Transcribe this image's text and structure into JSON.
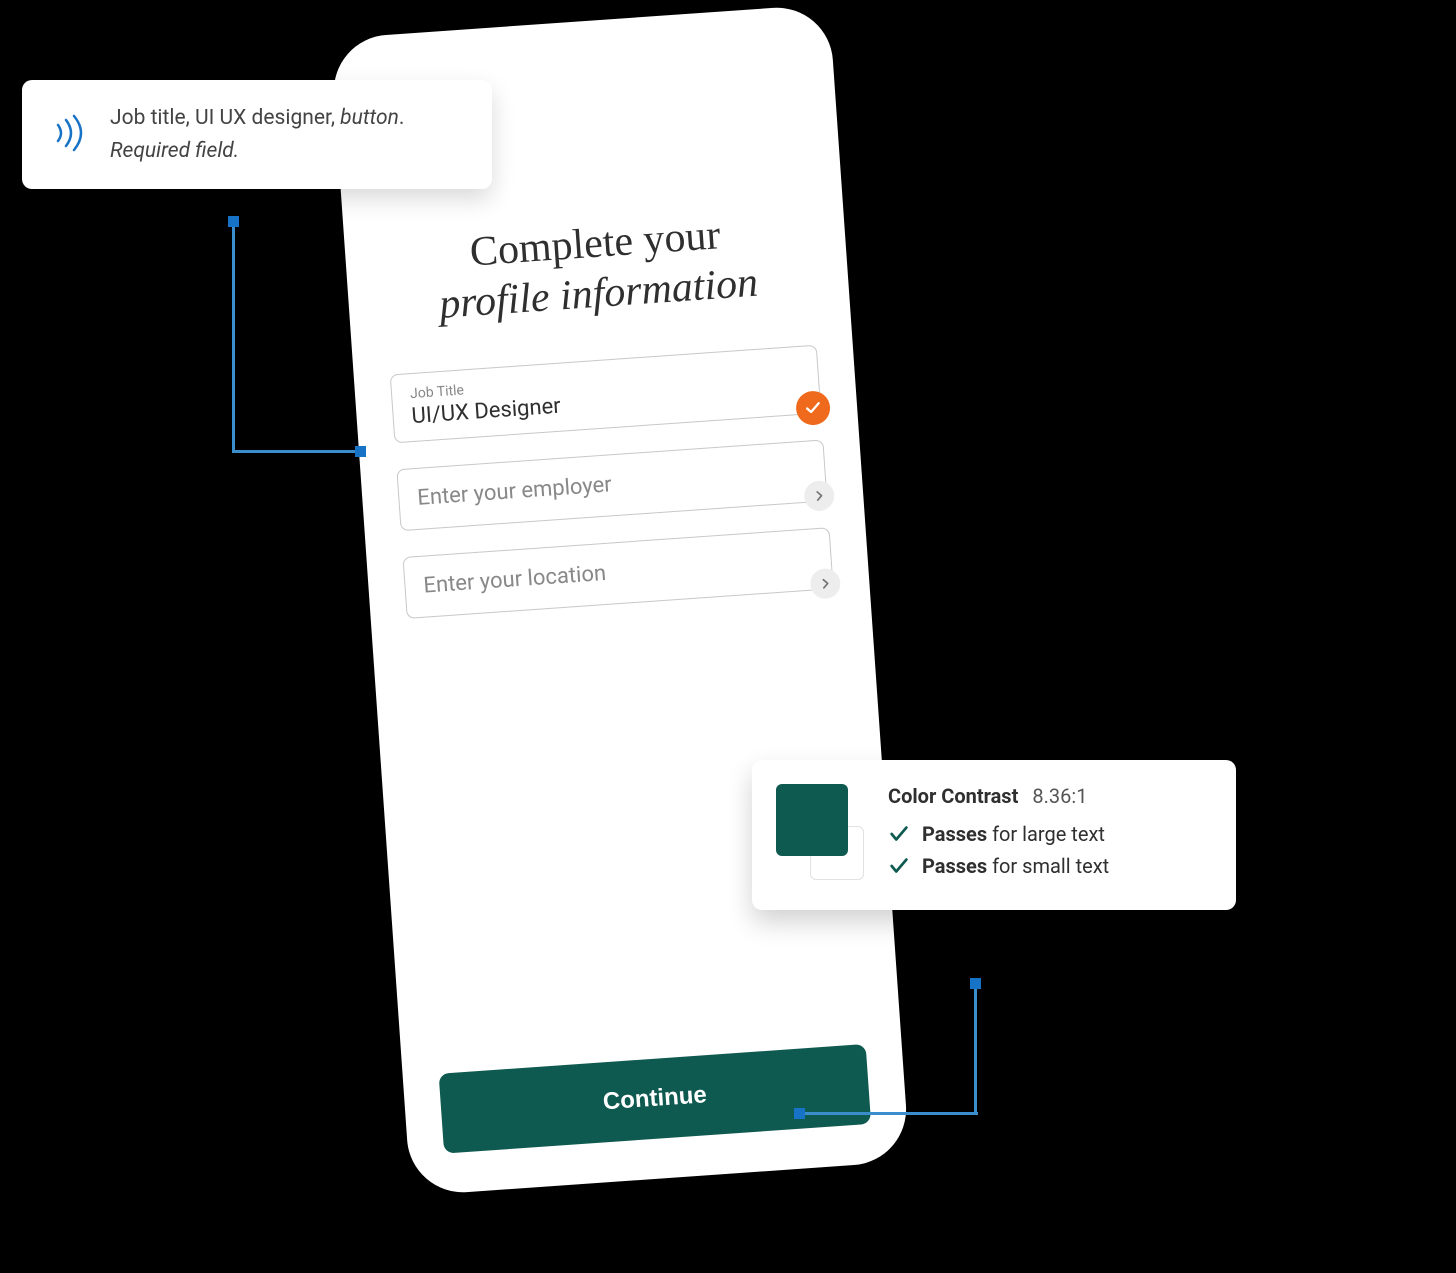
{
  "phone": {
    "heading_line1": "Complete your",
    "heading_line2": "profile information",
    "fields": {
      "jobTitle": {
        "label": "Job Title",
        "value": "UI/UX Designer"
      },
      "employer": {
        "placeholder": "Enter your employer"
      },
      "location": {
        "placeholder": "Enter your location"
      }
    },
    "continue_label": "Continue"
  },
  "screenReader": {
    "line1_prefix": "Job title, UI UX designer, ",
    "line1_button": "button",
    "line1_end": ". ",
    "line2": "Required field."
  },
  "contrast": {
    "title": "Color Contrast",
    "ratio": "8.36:1",
    "swatch_fg": "#0f5a50",
    "swatch_bg": "#ffffff",
    "checks": [
      {
        "bold": "Passes",
        "rest": " for large text"
      },
      {
        "bold": "Passes",
        "rest": " for small text"
      }
    ]
  }
}
